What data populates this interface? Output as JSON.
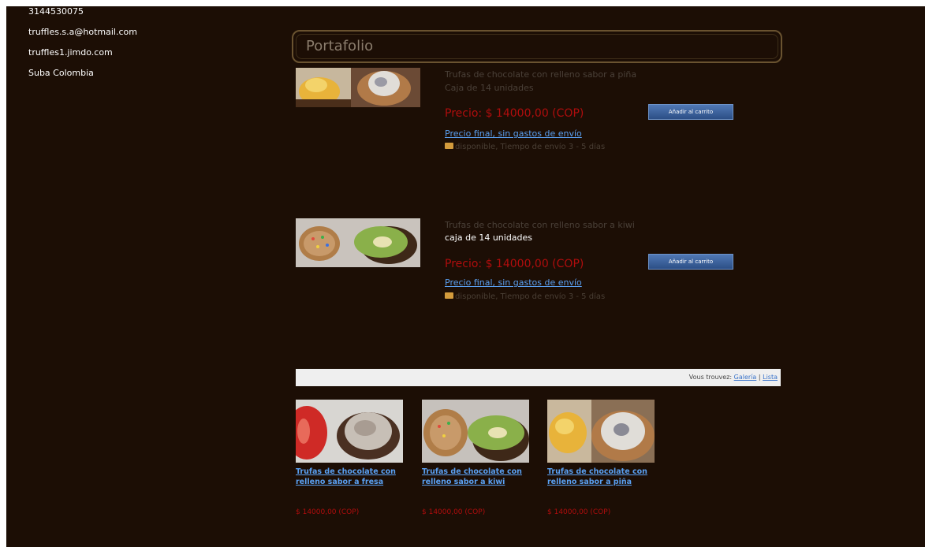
{
  "sidebar": {
    "phone": "3144530075",
    "email": "truffles.s.a@hotmail.com",
    "website": "truffles1.jimdo.com",
    "location": "Suba Colombia"
  },
  "section": {
    "title": "Portafolio"
  },
  "products": [
    {
      "title": "Trufas de chocolate con relleno sabor a piña",
      "subtitle": "Caja de 14 unidades",
      "price": "Precio: $ 14000,00 (COP)",
      "cart_button": "Añadir al carrito",
      "final_price_link": "Precio final, sin gastos de envío",
      "availability": "disponible, Tiempo de envío 3 - 5 días"
    },
    {
      "title": "Trufas de chocolate con relleno sabor a kiwi",
      "subtitle": "caja de 14 unidades",
      "price": "Precio: $ 14000,00 (COP)",
      "cart_button": "Añadir al carrito",
      "final_price_link": "Precio final, sin gastos de envío",
      "availability": "disponible, Tiempo de envío 3 - 5 días"
    }
  ],
  "gallery_nav": {
    "prefix": "Vous trouvez:",
    "gallery_link": "Galería",
    "separator": "|",
    "list_link": "Lista"
  },
  "gallery": [
    {
      "label": "Trufas de chocolate con relleno sabor a fresa",
      "price": "$ 14000,00 (COP)"
    },
    {
      "label": "Trufas de chocolate con relleno sabor a kiwi",
      "price": "$ 14000,00 (COP)"
    },
    {
      "label": "Trufas de chocolate con relleno sabor a piña",
      "price": "$ 14000,00 (COP)"
    }
  ],
  "colors": {
    "background": "#1c0e05",
    "price": "#b00d0d",
    "link": "#5aa0f2",
    "button": "#3a5f99"
  }
}
